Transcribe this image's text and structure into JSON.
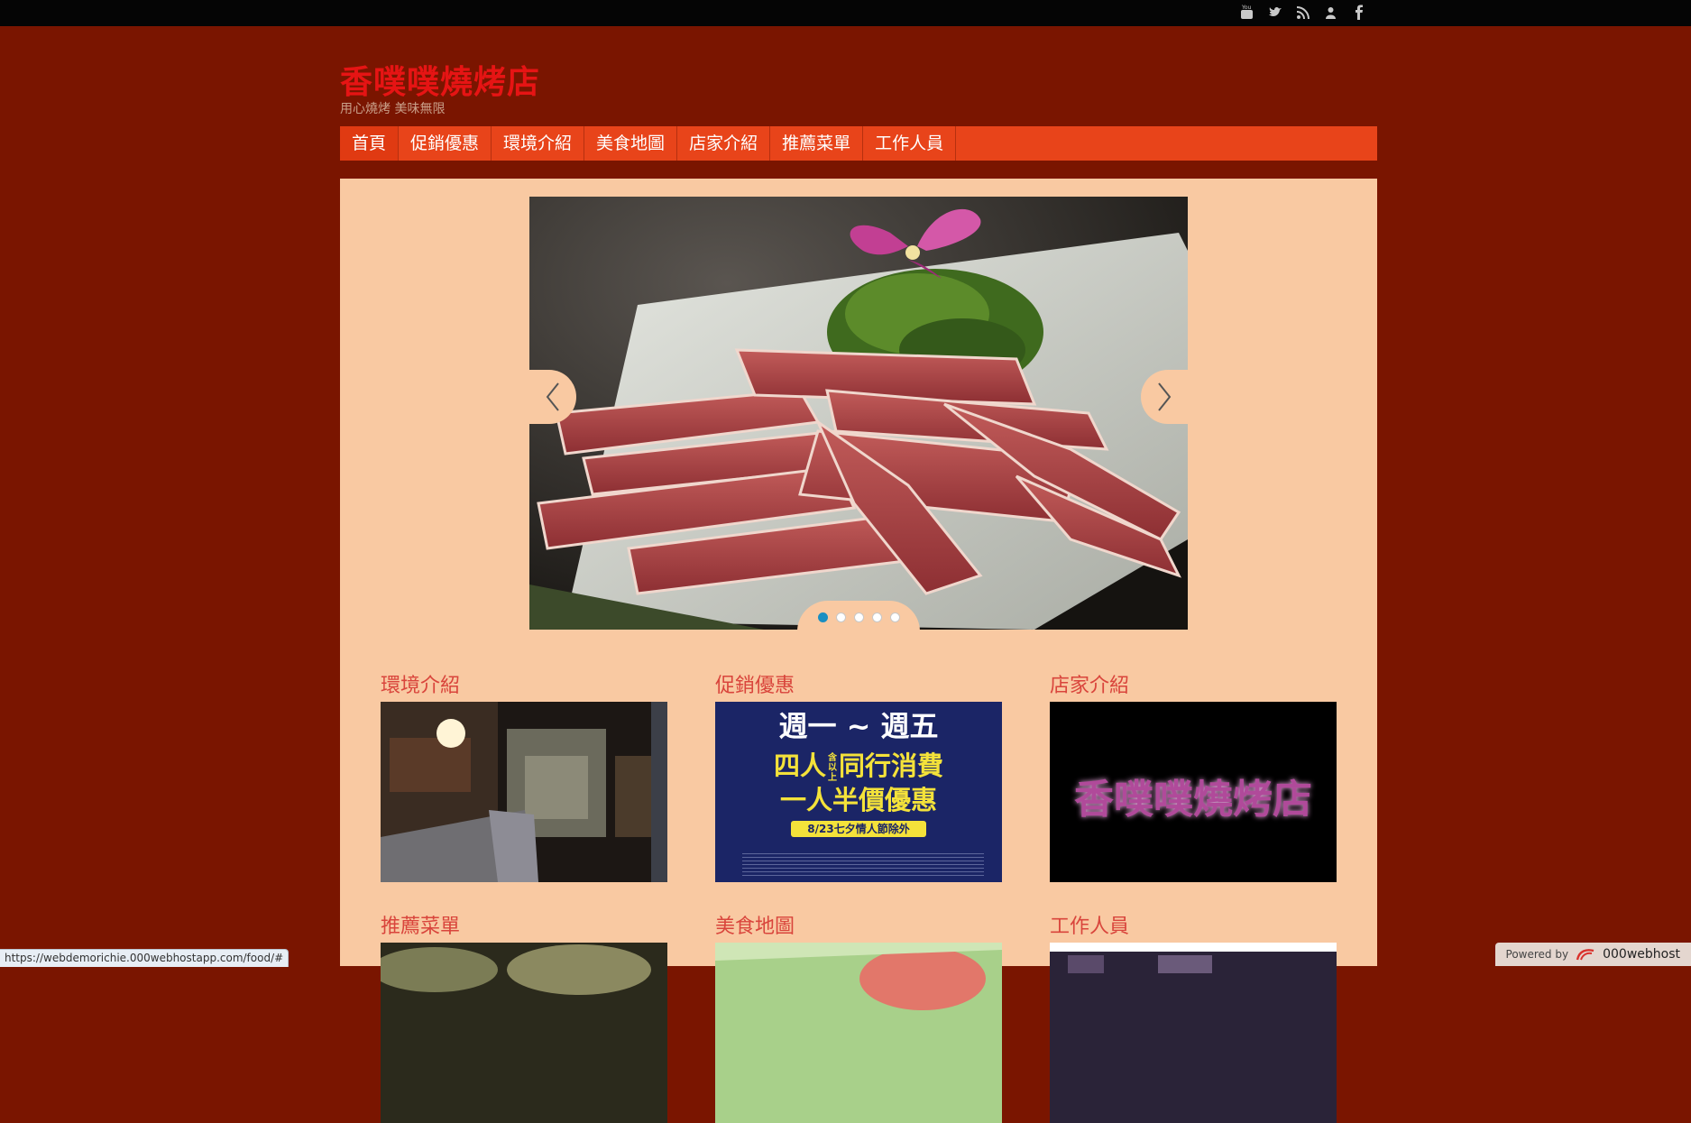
{
  "topbar": {
    "icons": [
      "youtube-icon",
      "twitter-icon",
      "rss-icon",
      "user-icon",
      "facebook-icon"
    ]
  },
  "site": {
    "title": "香噗噗燒烤店",
    "tagline": "用心燒烤 美味無限"
  },
  "nav": {
    "items": [
      "首頁",
      "促銷優惠",
      "環境介紹",
      "美食地圖",
      "店家介紹",
      "推薦菜單",
      "工作人員"
    ],
    "active_index": 0
  },
  "slider": {
    "slide_count": 5,
    "active_slide": 1
  },
  "sections": [
    {
      "title": "環境介紹"
    },
    {
      "title": "促銷優惠",
      "poster": {
        "line1": "週一 ~ 週五",
        "line2a": "四人",
        "line2_note": "含以上",
        "line2b": "同行消費",
        "line3": "一人半價優惠",
        "line4": "8/23七夕情人節除外"
      }
    },
    {
      "title": "店家介紹",
      "logo_text": "香噗噗燒烤店"
    },
    {
      "title": "推薦菜單"
    },
    {
      "title": "美食地圖"
    },
    {
      "title": "工作人員"
    }
  ],
  "status_url": "https://webdemorichie.000webhostapp.com/food/#",
  "powered": {
    "prefix": "Powered by",
    "brand": "000webhost"
  },
  "colors": {
    "page_bg": "#7a1500",
    "nav_bg": "#e8441a",
    "content_bg": "#f9c9a2",
    "title": "#e61414",
    "section_heading": "#d9453c"
  }
}
